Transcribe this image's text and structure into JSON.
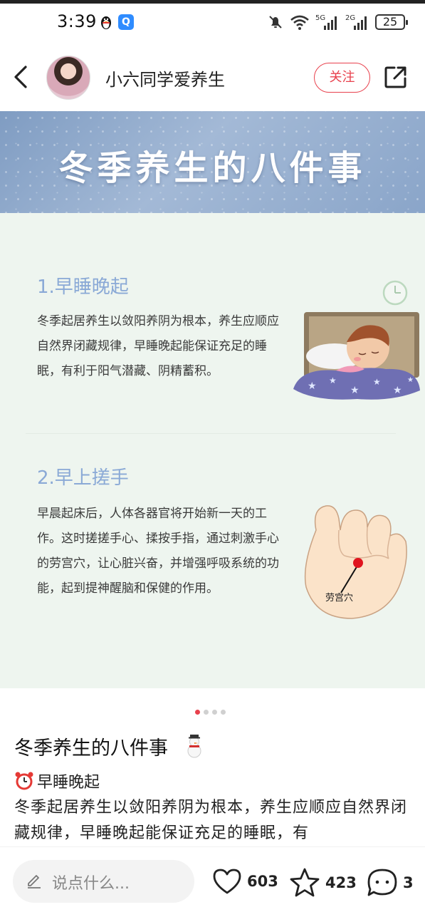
{
  "status_bar": {
    "time": "3:39",
    "battery": "25",
    "network_labels": [
      "5G",
      "2G"
    ],
    "icons": [
      "qq-penguin-icon",
      "q-app-icon",
      "mute-bell-icon",
      "wifi-icon",
      "signal-5g-icon",
      "signal-2g-icon",
      "battery-icon"
    ]
  },
  "header": {
    "username": "小六同学爱养生",
    "follow_label": "关注"
  },
  "post_image": {
    "banner_title": "冬季养生的八件事",
    "sections": [
      {
        "title": "1.早睡晚起",
        "body": "冬季起居养生以敛阳养阴为根本，养生应顺应自然界闭藏规律，早睡晚起能保证充足的睡眠，有利于阳气潜藏、阴精蓄积。"
      },
      {
        "title": "2.早上搓手",
        "body": "早晨起床后，人体各器官将开始新一天的工作。这时搓搓手心、揉按手指，通过刺激手心的劳宫穴，让心脏兴奋，并增强呼吸系统的功能，起到提神醒脑和保健的作用。"
      }
    ],
    "acupoint_label": "劳宫穴"
  },
  "carousel": {
    "total": 4,
    "active": 0
  },
  "caption": {
    "title": "冬季养生的八件事",
    "sub_heading": "早睡晚起",
    "body": "冬季起居养生以敛阳养阴为根本，养生应顺应自然界闭藏规律，早睡晚起能保证充足的睡眠，有"
  },
  "bottom_bar": {
    "comment_placeholder": "说点什么...",
    "likes": "603",
    "favorites": "423",
    "comments": "3"
  },
  "colors": {
    "accent": "#e8414d",
    "section_title": "#8aa9d6",
    "image_bg": "#eef5ef"
  }
}
